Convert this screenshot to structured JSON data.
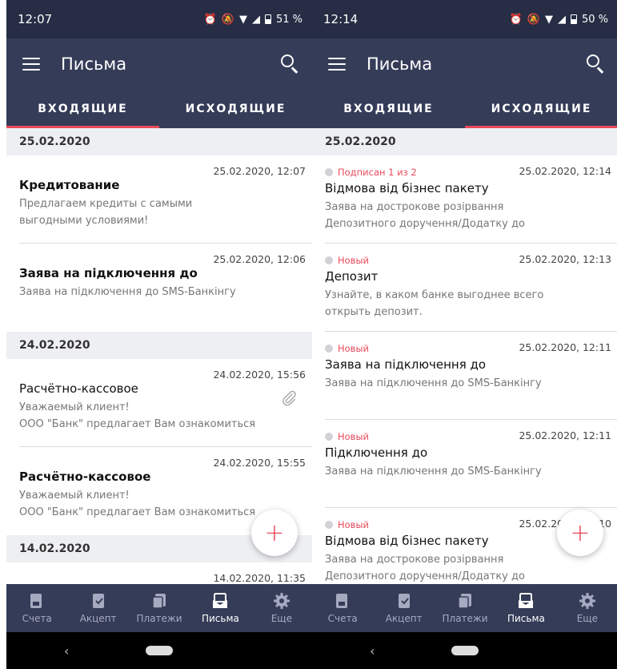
{
  "left": {
    "status_time": "12:07",
    "battery": "51 %",
    "title": "Письма",
    "tabs": [
      "ВХОДЯЩИЕ",
      "ИСХОДЯЩИЕ"
    ],
    "groups": [
      {
        "date": "25.02.2020",
        "items": [
          {
            "time": "25.02.2020, 12:07",
            "title": "Кредитование",
            "preview1": "Предлагаем кредиты с самыми",
            "preview2": "выгодными условиями!"
          },
          {
            "time": "25.02.2020, 12:06",
            "title": "Заява на підключення до",
            "preview1": "Заява на підключення до SMS-Банкінгу",
            "preview2": ""
          }
        ]
      },
      {
        "date": "24.02.2020",
        "items": [
          {
            "time": "24.02.2020, 15:56",
            "title": "Расчётно-кассовое",
            "preview1": "Уважаемый клиент!",
            "preview2": "ООО \"Банк\" предлагает Вам ознакомиться"
          },
          {
            "time": "24.02.2020, 15:55",
            "title": "Расчётно-кассовое",
            "preview1": "Уважаемый клиент!",
            "preview2": "ООО \"Банк\" предлагает Вам ознакомиться"
          }
        ]
      },
      {
        "date": "14.02.2020",
        "items": [
          {
            "time": "14.02.2020, 11:35"
          }
        ]
      }
    ]
  },
  "right": {
    "status_time": "12:14",
    "battery": "50 %",
    "title": "Письма",
    "tabs": [
      "ВХОДЯЩИЕ",
      "ИСХОДЯЩИЕ"
    ],
    "date": "25.02.2020",
    "items": [
      {
        "status": "Подписан 1 из 2",
        "time": "25.02.2020, 12:14",
        "title": "Відмова від бізнес пакету",
        "preview1": "Заява на дострокове розірвання",
        "preview2": "Депозитного доручення/Додатку до"
      },
      {
        "status": "Новый",
        "time": "25.02.2020, 12:13",
        "title": "Депозит",
        "preview1": "Узнайте, в каком банке выгоднее всего",
        "preview2": "открыть депозит."
      },
      {
        "status": "Новый",
        "time": "25.02.2020, 12:11",
        "title": "Заява на підключення до",
        "preview1": "Заява на підключення до SMS-Банкінгу",
        "preview2": ""
      },
      {
        "status": "Новый",
        "time": "25.02.2020, 12:11",
        "title": "Підключення до",
        "preview1": "Заява на підключення до SMS-Банкінгу",
        "preview2": ""
      },
      {
        "status": "Новый",
        "time": "25.02.2020, 12:10",
        "title": "Відмова від бізнес пакету",
        "preview1": "Заява на дострокове розірвання",
        "preview2": "Депозитного доручення/Додатку до"
      }
    ]
  },
  "nav": [
    "Счета",
    "Акцепт",
    "Платежи",
    "Письма",
    "Еще"
  ],
  "fab_label": "+",
  "colors": {
    "statusbar": "#262d44",
    "appbar": "#353c58",
    "accent": "#e84a5a",
    "nav_inactive": "#a6aac0"
  },
  "icons": [
    "menu-icon",
    "search-icon",
    "paperclip-icon",
    "accounts-icon",
    "accept-icon",
    "payments-icon",
    "letters-icon",
    "more-gear-icon",
    "alarm-icon",
    "mute-icon",
    "wifi-icon",
    "signal-icon",
    "battery-icon"
  ]
}
